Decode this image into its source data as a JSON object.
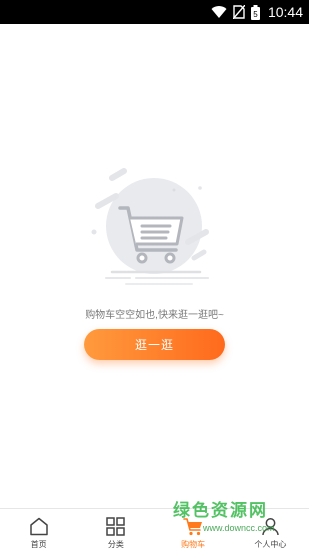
{
  "status_bar": {
    "time": "10:44",
    "battery_label": "5"
  },
  "empty_cart": {
    "message": "购物车空空如也,快来逛一逛吧~",
    "button_label": "逛一逛"
  },
  "bottom_nav": {
    "items": [
      {
        "label": "首页",
        "icon": "home-icon"
      },
      {
        "label": "分类",
        "icon": "grid-icon"
      },
      {
        "label": "购物车",
        "icon": "cart-icon",
        "active": true
      },
      {
        "label": "个人中心",
        "icon": "user-icon"
      }
    ]
  },
  "watermark": {
    "title": "绿色资源网",
    "url": "www.downcc.com"
  },
  "colors": {
    "accent": "#ff7a1c",
    "status_bar": "#000000",
    "illustration": "#e9eaee"
  }
}
